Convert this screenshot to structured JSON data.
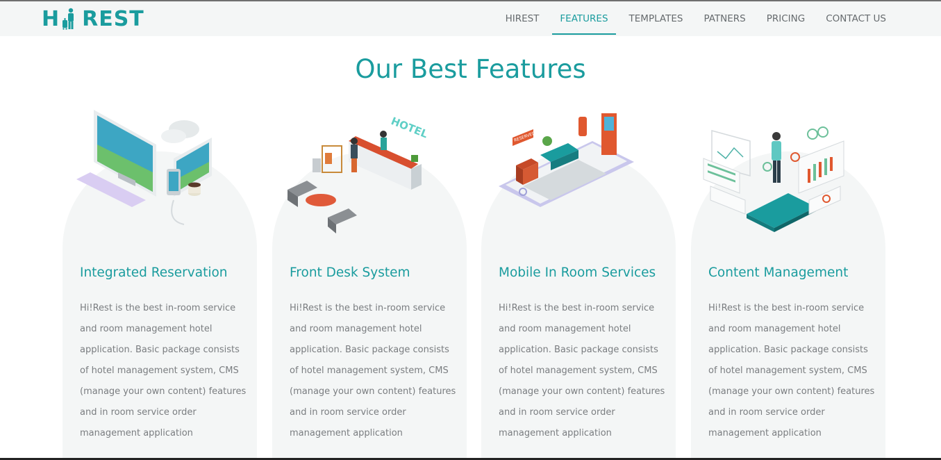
{
  "brand": {
    "name_left": "H",
    "name_right": "REST",
    "color": "#1a9c9e"
  },
  "nav": {
    "items": [
      {
        "label": "HIREST",
        "active": false
      },
      {
        "label": "FEATURES",
        "active": true
      },
      {
        "label": "TEMPLATES",
        "active": false
      },
      {
        "label": "PATNERS",
        "active": false
      },
      {
        "label": "PRICING",
        "active": false
      },
      {
        "label": "CONTACT US",
        "active": false
      }
    ]
  },
  "section": {
    "title": "Our Best Features",
    "features": [
      {
        "title": "Integrated Reservation",
        "icon": "devices-illustration",
        "text": "Hi!Rest is the best in-room service and room management hotel application. Basic package consists of hotel management system, CMS (manage your own content) features and in room service order management application"
      },
      {
        "title": "Front Desk System",
        "icon": "hotel-front-desk-illustration",
        "text": "Hi!Rest is the best in-room service and room management hotel application. Basic package consists of hotel management system, CMS (manage your own content) features and in room service order management application"
      },
      {
        "title": "Mobile In Room Services",
        "icon": "mobile-room-illustration",
        "text": "Hi!Rest is the best in-room service and room management hotel application. Basic package consists of hotel management system, CMS (manage your own content) features and in room service order management application"
      },
      {
        "title": "Content Management",
        "icon": "content-management-illustration",
        "text": "Hi!Rest is the best in-room service and room management hotel application. Basic package consists of hotel management system, CMS (manage your own content) features and in room service order management application"
      }
    ]
  },
  "colors": {
    "accent": "#1a9c9e",
    "card_bg": "#f4f6f6",
    "body_text": "#7a7d80",
    "nav_text": "#666b6e"
  }
}
